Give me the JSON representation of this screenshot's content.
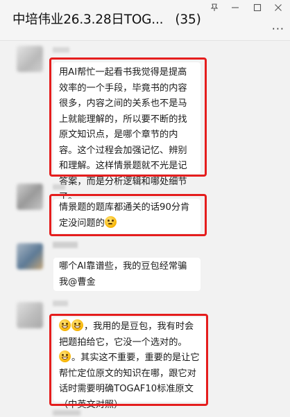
{
  "window": {
    "title": "中培伟业26.3.28日TOG...",
    "member_count": "(35)",
    "controls": [
      "pin-icon",
      "minimize-icon",
      "maximize-icon",
      "close-icon"
    ],
    "more_icon": "more-icon"
  },
  "messages": [
    {
      "text": "用AI帮忙一起看书我觉得是提高效率的一个手段，毕竟书的内容很多，内容之间的关系也不是马上就能理解的，所以要不断的找原文知识点，是哪个章节的内容。这个过程会加强记忆、辨别和理解。这样情景题就不光是记答案，而是分析逻辑和哪处细节了。",
      "highlighted": true
    },
    {
      "text": "情景题的题库都通关的话90分肯定没问题的",
      "emoji": "thinking-face-emoji",
      "highlighted": true
    },
    {
      "text": "哪个AI靠谱些，我的豆包经常骗我@曹金",
      "highlighted": false
    },
    {
      "parts": [
        "，我用的是豆包，我有时会把题拍给它，它没一个选对的。",
        "。其实这不重要，重要的是让它帮忙定位原文的知识在哪，跟它对话时需要明确TOGAF10标准原文（中英文对照）"
      ],
      "emoji": "grinning-face-emoji",
      "highlighted": true
    }
  ],
  "colors": {
    "background": "#f2f2f2",
    "bubble": "#ffffff",
    "highlight_box": "#e51d1d"
  }
}
